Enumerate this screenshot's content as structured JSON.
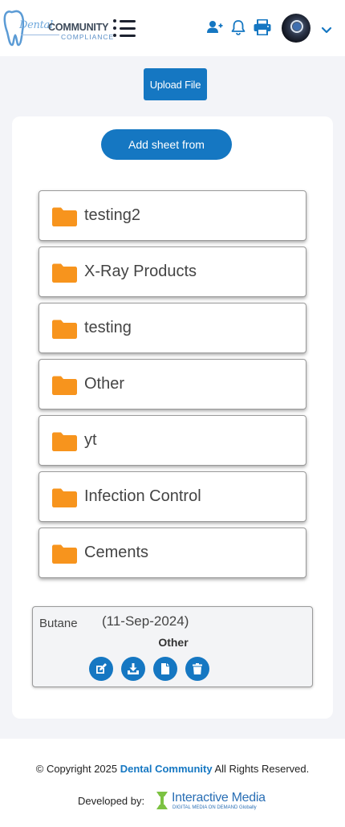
{
  "header": {
    "logo_text_1": "Dental",
    "logo_text_2": "COMMUNITY",
    "logo_text_3": "COMPLIANCE",
    "icons": [
      "hamburger-menu-icon",
      "add-user-icon",
      "bell-icon",
      "printer-icon",
      "chevron-down-icon"
    ],
    "accent_color": "#1577c2"
  },
  "main": {
    "upload_label": "Upload File",
    "add_sheet_label": "Add sheet from",
    "folders": [
      {
        "label": "testing2"
      },
      {
        "label": "X-Ray Products"
      },
      {
        "label": "testing"
      },
      {
        "label": "Other"
      },
      {
        "label": "yt"
      },
      {
        "label": "Infection Control"
      },
      {
        "label": "Cements"
      }
    ],
    "folder_icon_color": "#f7941d",
    "file": {
      "name": "Butane",
      "date": "(11-Sep-2024)",
      "category": "Other",
      "actions": [
        "edit-icon",
        "download-icon",
        "document-icon",
        "trash-icon"
      ]
    }
  },
  "footer": {
    "copyright_prefix": "© Copyright 2025 ",
    "copyright_brand": "Dental Community",
    "copyright_suffix": " All Rights Reserved.",
    "developed_by": "Developed by:",
    "developer_name": "Interactive Media",
    "developer_tagline": "DIGITAL MEDIA ON DEMAND Globally"
  }
}
